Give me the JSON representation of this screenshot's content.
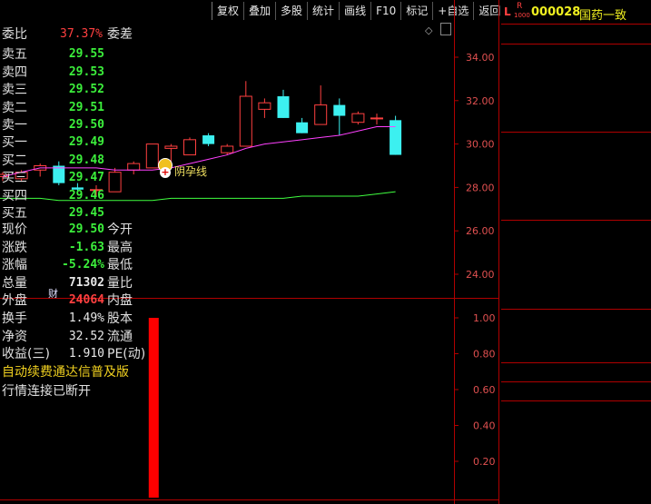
{
  "toolbar": {
    "items": [
      "复权",
      "叠加",
      "多股",
      "统计",
      "画线",
      "F10",
      "标记",
      "+自选",
      "返回"
    ]
  },
  "stock": {
    "prefix_l": "L",
    "prefix_r": "R",
    "prefix_sub": "1000",
    "code": "000028",
    "name": "国药一致"
  },
  "quote": {
    "weibi_label": "委比",
    "weibi_value": "37.37%",
    "weicha_label": "委差",
    "asks": [
      {
        "label": "卖五",
        "price": "29.55"
      },
      {
        "label": "卖四",
        "price": "29.53"
      },
      {
        "label": "卖三",
        "price": "29.52"
      },
      {
        "label": "卖二",
        "price": "29.51"
      },
      {
        "label": "卖一",
        "price": "29.50"
      }
    ],
    "bids": [
      {
        "label": "买一",
        "price": "29.49"
      },
      {
        "label": "买二",
        "price": "29.48"
      },
      {
        "label": "买三",
        "price": "29.47"
      },
      {
        "label": "买四",
        "price": "29.46"
      },
      {
        "label": "买五",
        "price": "29.45"
      }
    ],
    "stats": [
      {
        "label": "现价",
        "value": "29.50",
        "color": "#3cf03c",
        "label2": "今开"
      },
      {
        "label": "涨跌",
        "value": "-1.63",
        "color": "#3cf03c",
        "label2": "最高"
      },
      {
        "label": "涨幅",
        "value": "-5.24%",
        "color": "#3cf03c",
        "label2": "最低"
      },
      {
        "label": "总量",
        "value": "71302",
        "color": "#e8e8e8",
        "label2": "量比"
      },
      {
        "label": "外盘",
        "value": "24064",
        "color": "#ff4040",
        "label2": "内盘"
      }
    ],
    "info": [
      {
        "label": "换手",
        "value": "1.49%",
        "label2": "股本"
      },
      {
        "label": "净资",
        "value": "32.52",
        "label2": "流通"
      },
      {
        "label": "收益(三)",
        "value": "1.910",
        "label2": "PE(动)"
      }
    ],
    "banner": "自动续费通达信普及版",
    "status": "行情连接已断开"
  },
  "colors": {
    "up": "#ff4040",
    "down": "#3cf0f0",
    "ma1": "#ff40ff",
    "ma2": "#40ff40",
    "volbar": "#ff0000"
  },
  "price_axis": {
    "labels": [
      "34.00",
      "32.00",
      "30.00",
      "28.00",
      "26.00",
      "24.00"
    ],
    "values": [
      34,
      32,
      30,
      28,
      26,
      24
    ]
  },
  "vol_axis": {
    "labels": [
      "1.00",
      "0.80",
      "0.60",
      "0.40",
      "0.20"
    ],
    "values": [
      1.0,
      0.8,
      0.6,
      0.4,
      0.2
    ]
  },
  "annotation": {
    "label": "阴孕线"
  },
  "cai_marker": "财",
  "chart_data": {
    "type": "candlestick",
    "price_range": [
      23.0,
      35.0
    ],
    "candles": [
      {
        "o": 28.5,
        "h": 28.7,
        "l": 28.3,
        "c": 28.6
      },
      {
        "o": 28.4,
        "h": 28.8,
        "l": 28.3,
        "c": 28.7
      },
      {
        "o": 28.8,
        "h": 29.1,
        "l": 28.5,
        "c": 29.0
      },
      {
        "o": 29.0,
        "h": 29.2,
        "l": 28.1,
        "c": 28.2
      },
      {
        "o": 28.0,
        "h": 28.2,
        "l": 27.7,
        "c": 27.9
      },
      {
        "o": 27.9,
        "h": 28.1,
        "l": 27.6,
        "c": 27.9
      },
      {
        "o": 27.8,
        "h": 28.9,
        "l": 27.8,
        "c": 28.7
      },
      {
        "o": 28.8,
        "h": 29.2,
        "l": 28.6,
        "c": 29.1
      },
      {
        "o": 28.9,
        "h": 30.0,
        "l": 28.9,
        "c": 30.0
      },
      {
        "o": 29.8,
        "h": 30.0,
        "l": 29.0,
        "c": 29.9
      },
      {
        "o": 29.5,
        "h": 30.3,
        "l": 29.5,
        "c": 30.2
      },
      {
        "o": 30.4,
        "h": 30.5,
        "l": 29.9,
        "c": 30.0
      },
      {
        "o": 29.6,
        "h": 30.0,
        "l": 29.5,
        "c": 29.9
      },
      {
        "o": 29.9,
        "h": 32.9,
        "l": 29.9,
        "c": 32.2
      },
      {
        "o": 31.6,
        "h": 32.1,
        "l": 31.2,
        "c": 31.9
      },
      {
        "o": 32.2,
        "h": 32.5,
        "l": 31.2,
        "c": 31.2
      },
      {
        "o": 31.0,
        "h": 31.2,
        "l": 30.5,
        "c": 30.5
      },
      {
        "o": 30.9,
        "h": 32.7,
        "l": 30.9,
        "c": 31.8
      },
      {
        "o": 31.8,
        "h": 32.1,
        "l": 30.4,
        "c": 31.3
      },
      {
        "o": 31.0,
        "h": 31.5,
        "l": 30.9,
        "c": 31.4
      },
      {
        "o": 31.2,
        "h": 31.4,
        "l": 30.9,
        "c": 31.2
      },
      {
        "o": 31.1,
        "h": 31.3,
        "l": 29.5,
        "c": 29.5
      }
    ],
    "ma_series": [
      {
        "values": [
          28.5,
          28.7,
          28.9,
          28.9,
          28.9,
          28.9,
          28.8,
          28.8,
          28.8,
          28.9,
          29.1,
          29.3,
          29.5,
          29.8,
          30.0,
          30.1,
          30.2,
          30.3,
          30.4,
          30.6,
          30.8,
          30.8
        ]
      },
      {
        "values": [
          27.5,
          27.5,
          27.5,
          27.4,
          27.4,
          27.4,
          27.4,
          27.4,
          27.4,
          27.5,
          27.5,
          27.5,
          27.5,
          27.5,
          27.5,
          27.5,
          27.6,
          27.6,
          27.6,
          27.6,
          27.7,
          27.8
        ]
      }
    ],
    "volume": {
      "index": 8,
      "value": 1.0,
      "range": [
        0,
        1.05
      ]
    }
  }
}
